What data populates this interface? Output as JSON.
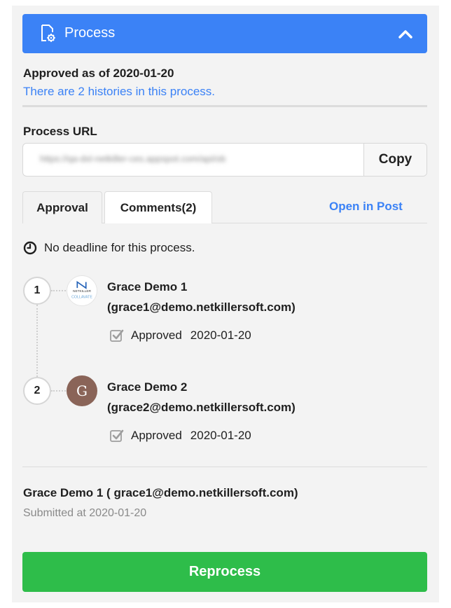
{
  "header": {
    "title": "Process",
    "doc_icon": "doc-gear-icon",
    "toggle_icon": "chevron-up-icon"
  },
  "status": {
    "approved_as_of": "Approved as of 2020-01-20",
    "history_link": "There are 2 histories in this process."
  },
  "process_url": {
    "label": "Process URL",
    "value": "https://qa-dxl-netkiller-ces.appspot.com/api/ob",
    "copy_label": "Copy"
  },
  "tabs": [
    {
      "label": "Approval",
      "active": true
    },
    {
      "label": "Comments(2)",
      "active": false
    }
  ],
  "open_in_post": "Open in Post",
  "deadline_text": "No deadline for this process.",
  "approvers": [
    {
      "step": "1",
      "name": "Grace Demo 1",
      "email": "(grace1@demo.netkillersoft.com)",
      "status": "Approved",
      "date": "2020-01-20",
      "avatar_text_top": "NETKILLER",
      "avatar_text_bottom": "COLLAVATE"
    },
    {
      "step": "2",
      "name": "Grace Demo 2",
      "email": "(grace2@demo.netkillersoft.com)",
      "status": "Approved",
      "date": "2020-01-20",
      "avatar_initial": "G"
    }
  ],
  "submitter": {
    "name": "Grace Demo 1 ( grace1@demo.netkillersoft.com)",
    "submitted_at": "Submitted at 2020-01-20"
  },
  "reprocess_label": "Reprocess",
  "colors": {
    "accent_blue": "#3b82f6",
    "reprocess_green": "#2ebd4a",
    "avatar2_brown": "#8a6458"
  }
}
